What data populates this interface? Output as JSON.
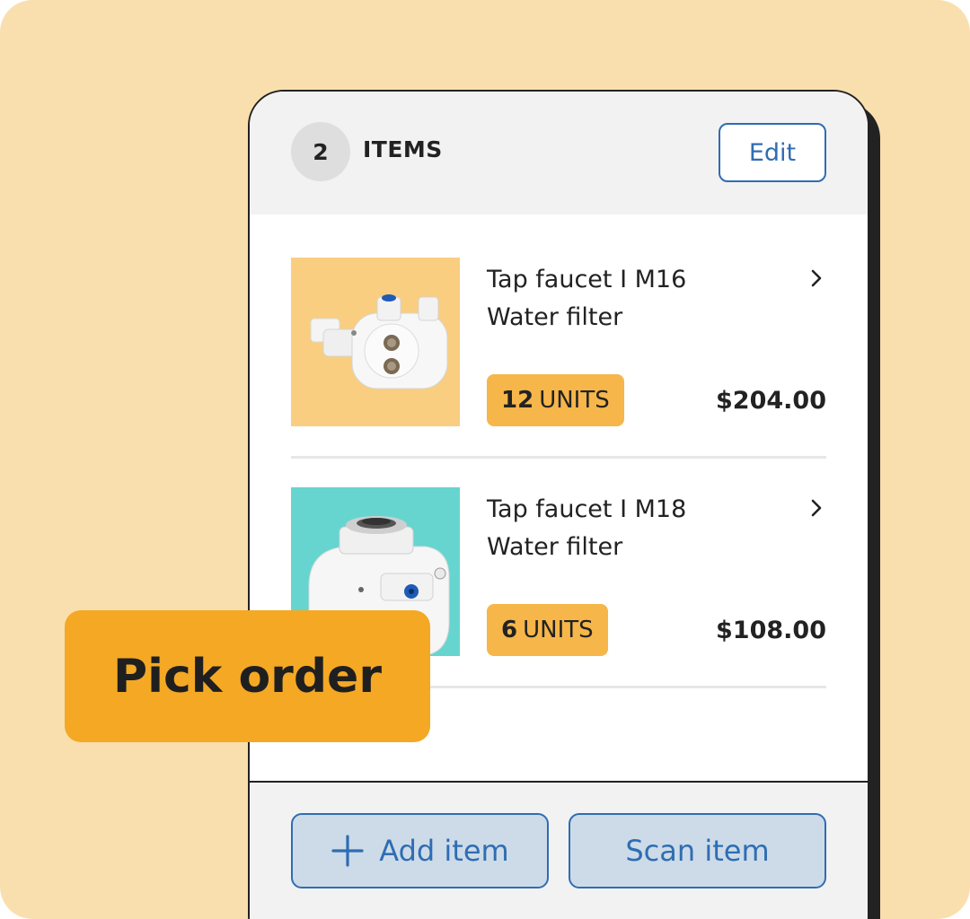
{
  "cart": {
    "count": "2",
    "items_label": "ITEMS",
    "edit_label": "Edit"
  },
  "items": [
    {
      "title_line1": "Tap faucet  I  M16",
      "title_line2": "Water filter",
      "units_count": "12",
      "units_label": "UNITS",
      "price": "$204.00",
      "thumb_color": "#f9ce80"
    },
    {
      "title_line1": "Tap faucet  I  M18",
      "title_line2": "Water filter",
      "units_count": "6",
      "units_label": "UNITS",
      "price": "$108.00",
      "thumb_color": "#66d5d0"
    }
  ],
  "actions": {
    "add_label": "Add item",
    "scan_label": "Scan item"
  },
  "banner": {
    "label": "Pick order"
  },
  "colors": {
    "background": "#fadfae",
    "accent_blue": "#2f6db3",
    "badge_orange": "#f6b64a",
    "banner_orange": "#f4a824"
  },
  "icons": [
    "chevron-right-icon",
    "plus-icon"
  ]
}
